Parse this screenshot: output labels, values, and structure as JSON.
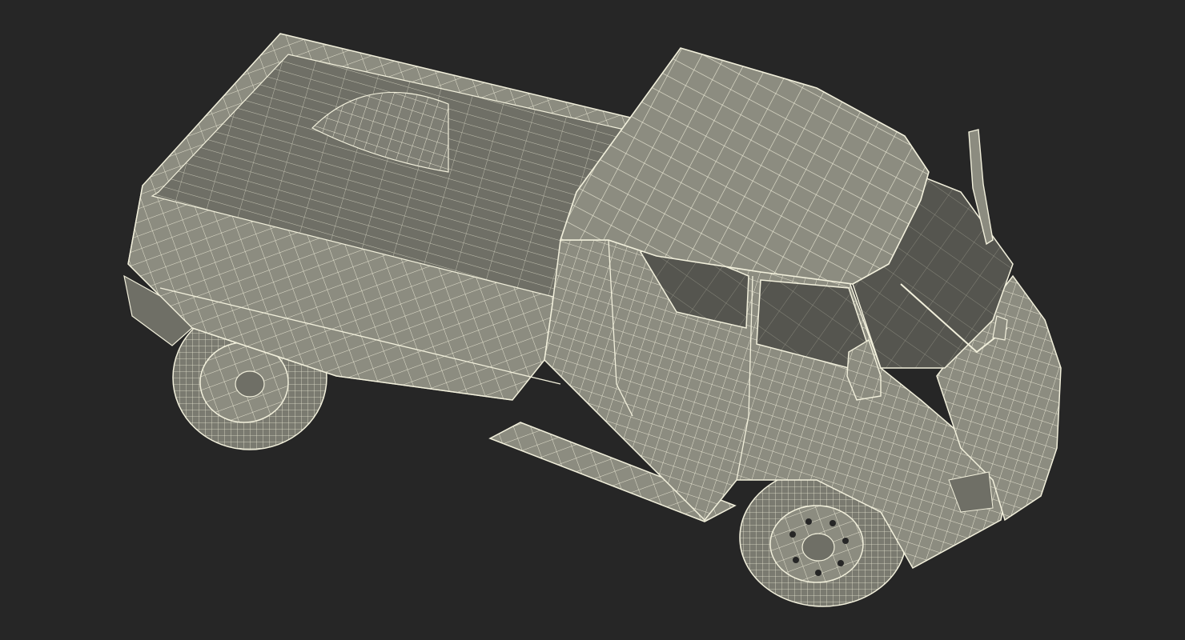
{
  "scene": {
    "subject": "pickup-truck-wireframe",
    "colors": {
      "background": "#262626",
      "body_fill": "#8c8c80",
      "body_dark": "#6f6f66",
      "body_light": "#a6a698",
      "wire": "#f2f0dc",
      "glass": "#55554f",
      "tire": "#7a7a70",
      "shadow": "#4a4a44"
    }
  }
}
